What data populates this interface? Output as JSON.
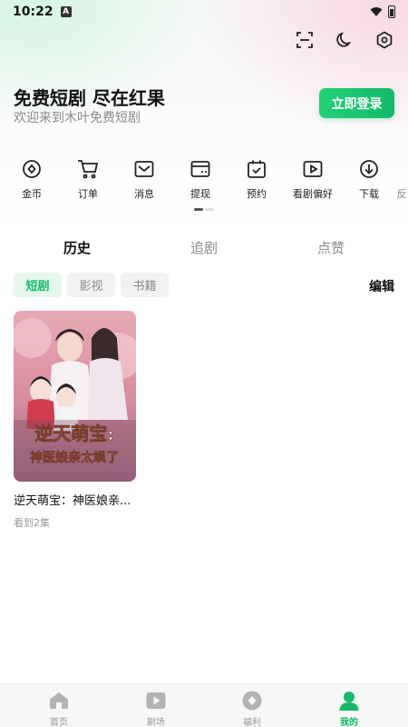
{
  "status_bar": {
    "time": "10:22",
    "notif_letter": "A"
  },
  "top_icons": [
    "scan-icon",
    "moon-icon",
    "settings-hex-icon"
  ],
  "promo": {
    "title": "免费短剧 尽在红果",
    "subtitle": "欢迎来到木叶免费短剧",
    "login_label": "立即登录"
  },
  "quick_actions": [
    {
      "icon": "coin-icon",
      "label": "金币"
    },
    {
      "icon": "cart-icon",
      "label": "订单"
    },
    {
      "icon": "message-icon",
      "label": "消息"
    },
    {
      "icon": "wallet-icon",
      "label": "提现"
    },
    {
      "icon": "calendar-icon",
      "label": "预约"
    },
    {
      "icon": "play-icon",
      "label": "看剧偏好"
    },
    {
      "icon": "download-icon",
      "label": "下载"
    },
    {
      "icon": "partial-icon",
      "label": "反"
    }
  ],
  "main_tabs": [
    {
      "label": "历史",
      "active": true
    },
    {
      "label": "追剧",
      "active": false
    },
    {
      "label": "点赞",
      "active": false
    }
  ],
  "chips": [
    {
      "label": "短剧",
      "active": true
    },
    {
      "label": "影视",
      "active": false
    },
    {
      "label": "书籍",
      "active": false
    }
  ],
  "edit_label": "编辑",
  "history_items": [
    {
      "title": "逆天萌宝：神医娘亲...",
      "progress": "看到2集",
      "cover_text_1": "逆天萌宝:",
      "cover_text_2": "神医娘亲太飒了"
    }
  ],
  "bottom_nav": [
    {
      "icon": "home-icon",
      "label": "首页",
      "active": false
    },
    {
      "icon": "theater-icon",
      "label": "剧场",
      "active": false
    },
    {
      "icon": "welfare-icon",
      "label": "福利",
      "active": false
    },
    {
      "icon": "profile-icon",
      "label": "我的",
      "active": true
    }
  ],
  "colors": {
    "accent": "#18b96a",
    "chip_active_bg": "#e4f7ec"
  }
}
